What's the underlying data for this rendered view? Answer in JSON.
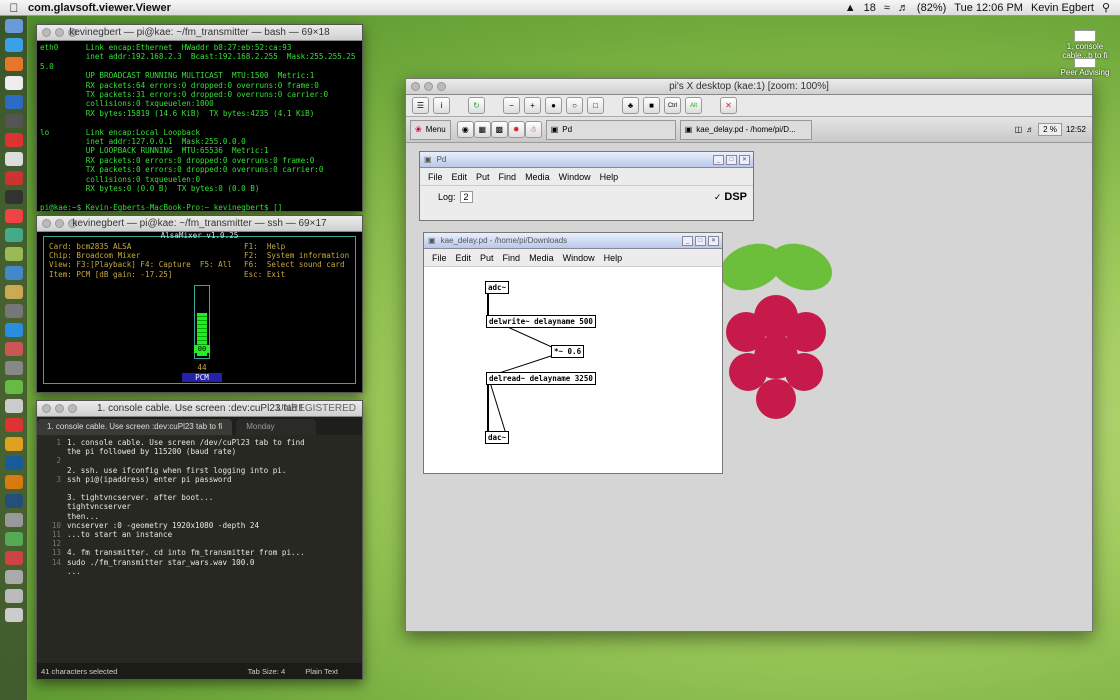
{
  "menubar": {
    "app_name": "com.glavsoft.viewer.Viewer",
    "clock": "Tue 12:06 PM",
    "user": "Kevin Egbert",
    "battery": "(82%)",
    "badge": "18"
  },
  "terminal1": {
    "title": "kevinegbert — pi@kae: ~/fm_transmitter — bash — 69×18",
    "text": "eth0      Link encap:Ethernet  HWaddr b8:27:eb:52:ca:93\n          inet addr:192.168.2.3  Bcast:192.168.2.255  Mask:255.255.25\n5.0\n          UP BROADCAST RUNNING MULTICAST  MTU:1500  Metric:1\n          RX packets:64 errors:0 dropped:0 overruns:0 frame:0\n          TX packets:31 errors:0 dropped:0 overruns:0 carrier:0\n          collisions:0 txqueuelen:1000\n          RX bytes:15819 (14.6 KiB)  TX bytes:4235 (4.1 KiB)\n\nlo        Link encap:Local Loopback\n          inet addr:127.0.0.1  Mask:255.0.0.0\n          UP LOOPBACK RUNNING  MTU:65536  Metric:1\n          RX packets:0 errors:0 dropped:0 overruns:0 frame:0\n          TX packets:0 errors:0 dropped:0 overruns:0 carrier:0\n          collisions:0 txqueuelen:0\n          RX bytes:0 (0.0 B)  TX bytes:0 (0.0 B)\n\npi@kae:~$ Kevin-Egberts-MacBook-Pro:~ kevinegbert$ []"
  },
  "terminal2": {
    "title": "kevinegbert — pi@kae: ~/fm_transmitter — ssh — 69×17",
    "alsa_header": "AlsaMixer v1.0.25",
    "alsa_info": "Card: bcm2835 ALSA\nChip: Broadcom Mixer\nView: F3:[Playback] F4: Capture  F5: All\nItem: PCM [dB gain: -17.25]",
    "alsa_help": "F1:  Help\nF2:  System information\nF6:  Select sound card\nEsc: Exit",
    "level_label": "00",
    "level_value": "44",
    "control_name": "PCM",
    "level_fraction": 0.6
  },
  "editor": {
    "title": "1. console cable. Use screen :dev:cuPl23 tab to fi",
    "unregistered": "UNREGISTERED",
    "tabs": [
      "1. console cable. Use screen :dev:cuPl23 tab to fi",
      "Monday"
    ],
    "line_numbers": "1\n\n2\n\n3\n\n\n\n\n10\n11\n12\n13\n14",
    "code": "1. console cable. Use screen /dev/cuPl23 tab to find\nthe pi followed by 115200 (baud rate)\n\n2. ssh. use ifconfig when first logging into pi.\nssh pi@(ipaddress) enter pi password\n\n3. tightvncserver. after boot...\ntightvncserver\nthen...\nvncserver :0 -geometry 1920x1080 -depth 24\n...to start an instance\n\n4. fm transmitter. cd into fm_transmitter from pi...\nsudo ./fm_transmitter star_wars.wav 100.0\n...",
    "status_left": "41 characters selected",
    "tab_size": "Tab Size: 4",
    "syntax": "Plain Text"
  },
  "vnc": {
    "title": "pi's X desktop (kae:1) [zoom: 100%]",
    "toolbar_labels": {
      "ctrl": "Ctrl",
      "alt": "Alt"
    },
    "panel": {
      "menu_label": "Menu",
      "task1": "Pd",
      "task2": "kae_delay.pd - /home/pi/D...",
      "cpu": "2 %",
      "time": "12:52"
    }
  },
  "pd_main": {
    "title": "Pd",
    "menu": [
      "File",
      "Edit",
      "Put",
      "Find",
      "Media",
      "Window",
      "Help"
    ],
    "log_label": "Log:",
    "log_value": "2",
    "dsp_label": "DSP"
  },
  "pd_patch": {
    "title": "kae_delay.pd - /home/pi/Downloads",
    "menu": [
      "File",
      "Edit",
      "Put",
      "Find",
      "Media",
      "Window",
      "Help"
    ],
    "objects": {
      "adc": "adc~",
      "delwrite": "delwrite~ delayname 500",
      "mul": "*~ 0.6",
      "delread": "delread~ delayname 3250",
      "dac": "dac~"
    }
  },
  "right_notes": {
    "note1": "1. console cable...b to fi",
    "note2": "Peer Advising"
  }
}
